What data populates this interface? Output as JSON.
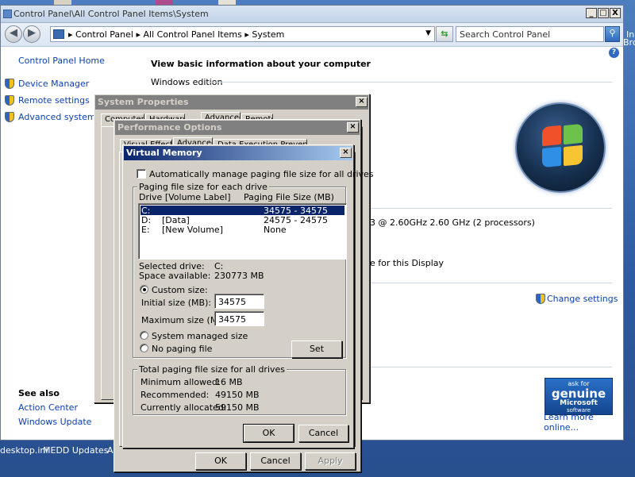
{
  "desktop": {
    "icons": [
      "desktop.ini",
      "MEDD Updates",
      "A"
    ],
    "right_edge_text": [
      "In",
      "Bro"
    ]
  },
  "window": {
    "title": "Control Panel\\All Control Panel Items\\System",
    "breadcrumbs": [
      "Control Panel",
      "All Control Panel Items",
      "System"
    ],
    "search_placeholder": "Search Control Panel",
    "minimize": "_",
    "maximize": "□",
    "close": "X"
  },
  "sidebar": {
    "home": "Control Panel Home",
    "items": [
      {
        "label": "Device Manager",
        "icon": "shield-icon"
      },
      {
        "label": "Remote settings",
        "icon": "shield-icon"
      },
      {
        "label": "Advanced system setti",
        "icon": "shield-icon"
      }
    ],
    "see_also_heading": "See also",
    "see_also": [
      "Action Center",
      "Windows Update"
    ]
  },
  "main": {
    "heading": "View basic information about your computer",
    "edition_label": "Windows edition",
    "processor_fragment": "3 @ 2.60GHz   2.60 GHz  (2 processors)",
    "display_fragment": "e for this Display",
    "change_settings": "Change settings",
    "genuine": {
      "line1": "ask for",
      "line2": "genuine",
      "line3": "Microsoft",
      "line4": "software"
    },
    "learn_more": "Learn more online..."
  },
  "system_properties": {
    "title": "System Properties",
    "tabs": [
      "Computer Name",
      "Hardware",
      "Advanced",
      "Remote"
    ],
    "buttons": {
      "ok": "OK",
      "cancel": "Cancel",
      "apply": "Apply"
    }
  },
  "performance_options": {
    "title": "Performance Options",
    "tabs": [
      "Visual Effects",
      "Advanced",
      "Data Execution Prevention"
    ]
  },
  "virtual_memory": {
    "title": "Virtual Memory",
    "auto_manage_label": "Automatically manage paging file size for all drives",
    "auto_manage_checked": false,
    "paging_group": "Paging file size for each drive",
    "col_drive": "Drive  [Volume Label]",
    "col_size": "Paging File Size (MB)",
    "drives": [
      {
        "drive": "C:",
        "label": "",
        "size": "34575 - 34575",
        "selected": true
      },
      {
        "drive": "D:",
        "label": "[Data]",
        "size": "24575 - 24575",
        "selected": false
      },
      {
        "drive": "E:",
        "label": "[New Volume]",
        "size": "None",
        "selected": false
      }
    ],
    "selected_drive_label": "Selected drive:",
    "selected_drive_value": "C:",
    "space_label": "Space available:",
    "space_value": "230773 MB",
    "custom_size_label": "Custom size:",
    "initial_label": "Initial size (MB):",
    "initial_value": "34575",
    "max_label": "Maximum size (MB):",
    "max_value": "34575",
    "system_managed_label": "System managed size",
    "no_paging_label": "No paging file",
    "set_button": "Set",
    "total_group": "Total paging file size for all drives",
    "min_allowed_label": "Minimum allowed:",
    "min_allowed_value": "16 MB",
    "recommended_label": "Recommended:",
    "recommended_value": "49150 MB",
    "allocated_label": "Currently allocated:",
    "allocated_value": "59150 MB",
    "ok": "OK",
    "cancel": "Cancel"
  }
}
